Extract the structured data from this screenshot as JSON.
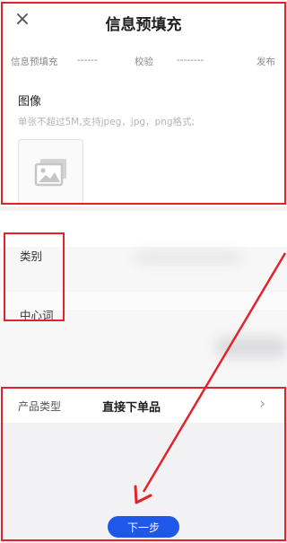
{
  "header": {
    "close_icon": "×",
    "title": "信息预填充"
  },
  "steps": {
    "step1": "信息预填充",
    "dash1": "------",
    "step2": "校验",
    "dash2": "--------",
    "step3": "发布"
  },
  "image_section": {
    "label": "图像",
    "hint": "单张不超过5M,支持jpeg，jpg，png格式;",
    "upload_icon": "image-placeholder-icon"
  },
  "fields": {
    "category_label": "类别",
    "keyword_label": "中心词"
  },
  "product": {
    "label": "产品类型",
    "value": "直接下单品",
    "chevron": "›"
  },
  "footer": {
    "next_label": "下一步"
  },
  "annotation": {
    "highlight_color": "#e0242a",
    "button_color": "#1f57e8"
  }
}
